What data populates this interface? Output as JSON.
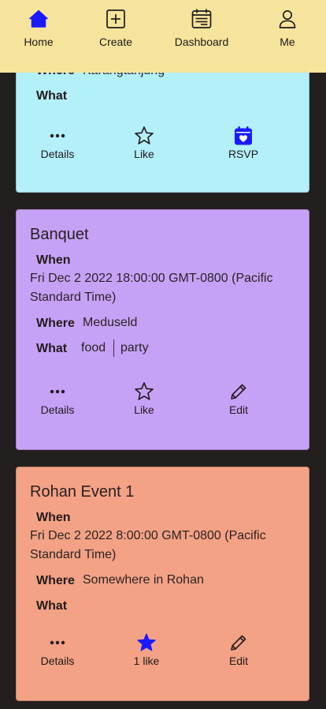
{
  "nav": {
    "items": [
      {
        "label": "Home",
        "icon": "home-icon",
        "active": true
      },
      {
        "label": "Create",
        "icon": "plus-square-icon"
      },
      {
        "label": "Dashboard",
        "icon": "calendar-dashboard-icon"
      },
      {
        "label": "Me",
        "icon": "person-icon"
      }
    ],
    "active_color": "#1a1aff"
  },
  "cards": [
    {
      "color": "#b3f0f9",
      "where_label": "Where",
      "where_value": "Karangtanjung",
      "what_label": "What",
      "actions": [
        {
          "label": "Details",
          "icon": "more-dots-icon"
        },
        {
          "label": "Like",
          "icon": "star-outline-icon"
        },
        {
          "label": "RSVP",
          "icon": "calendar-heart-icon"
        }
      ]
    },
    {
      "color": "#c6a2f7",
      "title": "Banquet",
      "when_label": "When",
      "when_value": "Fri Dec 2 2022 18:00:00 GMT-0800 (Pacific Standard Time)",
      "where_label": "Where",
      "where_value": "Meduseld",
      "what_label": "What",
      "tags": [
        "food",
        "party"
      ],
      "actions": [
        {
          "label": "Details",
          "icon": "more-dots-icon"
        },
        {
          "label": "Like",
          "icon": "star-outline-icon"
        },
        {
          "label": "Edit",
          "icon": "pencil-icon"
        }
      ]
    },
    {
      "color": "#f3a285",
      "title": "Rohan Event 1",
      "when_label": "When",
      "when_value": "Fri Dec 2 2022 8:00:00 GMT-0800 (Pacific Standard Time)",
      "where_label": "Where",
      "where_value": "Somewhere in Rohan",
      "what_label": "What",
      "actions": [
        {
          "label": "Details",
          "icon": "more-dots-icon"
        },
        {
          "label": "1 like",
          "icon": "star-filled-icon"
        },
        {
          "label": "Edit",
          "icon": "pencil-icon"
        }
      ]
    }
  ]
}
